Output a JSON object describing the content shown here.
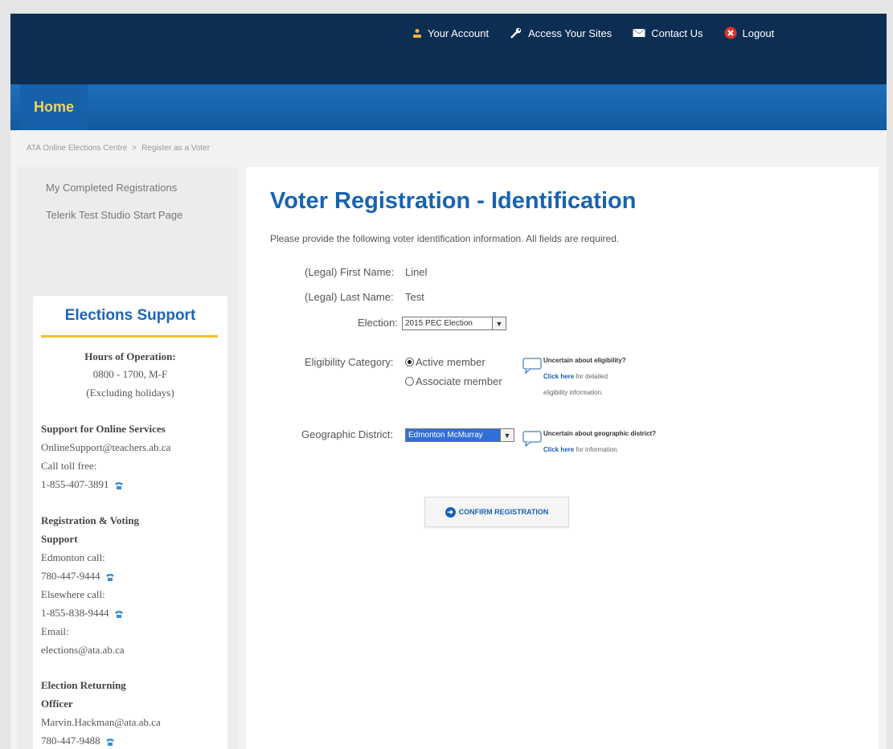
{
  "topnav": {
    "account": "Your Account",
    "access": "Access Your Sites",
    "contact": "Contact Us",
    "logout": "Logout"
  },
  "nav": {
    "home": "Home"
  },
  "breadcrumb": {
    "root": "ATA Online Elections Centre",
    "sep": ">",
    "current": "Register as a Voter"
  },
  "sidebar": {
    "links": [
      "My Completed Registrations",
      "Telerik Test Studio Start Page"
    ],
    "support": {
      "title": "Elections Support",
      "hours_title": "Hours of Operation:",
      "hours": "0800 - 1700, M-F",
      "hours_note": "(Excluding holidays)",
      "online_title": "Support for Online Services",
      "online_email": "OnlineSupport@teachers.ab.ca",
      "online_call": "Call toll free:",
      "online_phone": "1-855-407-3891",
      "reg_title_1": "Registration & Voting",
      "reg_title_2": "Support",
      "edm_call": "Edmonton call:",
      "edm_phone": "780-447-9444",
      "else_call": "Elsewhere call:",
      "else_phone": "1-855-838-9444",
      "email_label": "Email:",
      "email": "elections@ata.ab.ca",
      "officer_title_1": "Election Returning",
      "officer_title_2": "Officer",
      "officer_email": "Marvin.Hackman@ata.ab.ca",
      "officer_phone": "780-447-9488"
    }
  },
  "main": {
    "title": "Voter Registration - Identification",
    "instructions": "Please provide the following voter identification information. All fields are required.",
    "first_name_label": "(Legal) First Name:",
    "first_name": "Linel",
    "last_name_label": "(Legal) Last Name:",
    "last_name": "Test",
    "election_label": "Election:",
    "election_value": "2015 PEC Election",
    "eligibility_label": "Eligibility Category:",
    "eligibility_options": [
      "Active member",
      "Associate member"
    ],
    "eligibility_help_q": "Uncertain about eligibility?",
    "eligibility_help_link": "Click here",
    "eligibility_help_rest": "for detailed",
    "eligibility_help_rest2": "eligibility information.",
    "district_label": "Geographic District:",
    "district_value": "Edmonton McMurray",
    "district_help_q": "Uncertain about geographic district?",
    "district_help_link": "Click here",
    "district_help_rest": "for information.",
    "confirm": "CONFIRM REGISTRATION"
  }
}
